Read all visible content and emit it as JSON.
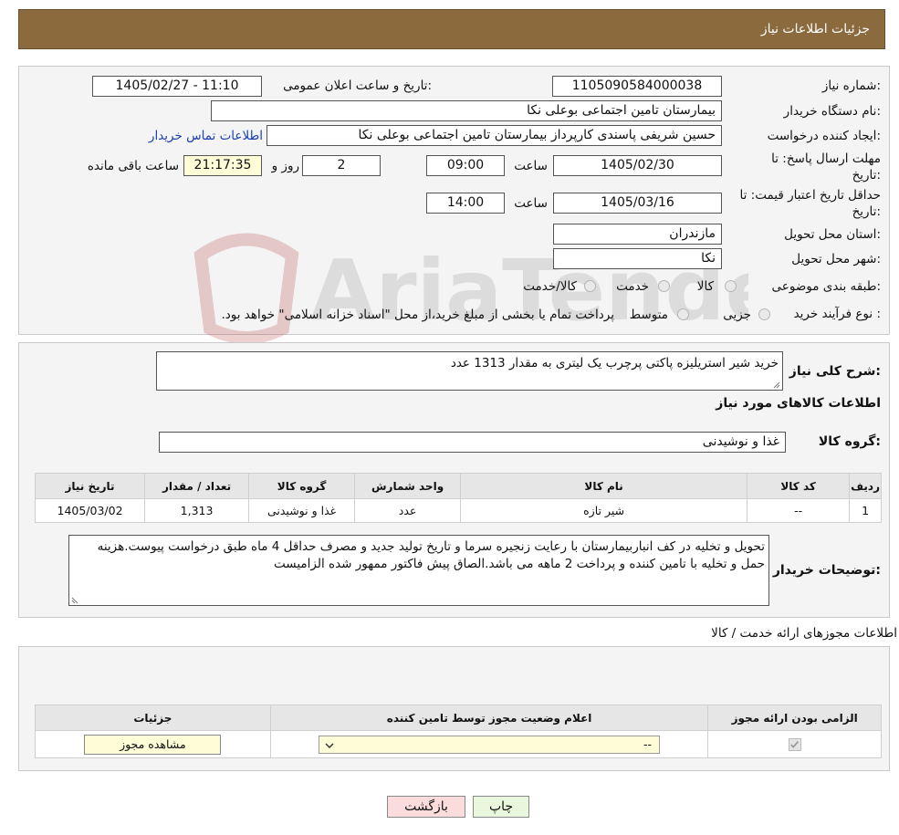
{
  "header": {
    "title": "جزئیات اطلاعات نیاز"
  },
  "watermark_text": "AriaTender.neT",
  "form": {
    "need_number": {
      "label": "شماره نیاز:",
      "value": "1105090584000038"
    },
    "announce": {
      "label": "تاریخ و ساعت اعلان عمومی:",
      "value": "1405/02/27 - 11:10"
    },
    "buyer": {
      "label": "نام دستگاه خریدار:",
      "value": "بیمارستان تامین اجتماعی بوعلی نکا"
    },
    "creator": {
      "label": "ایجاد کننده درخواست:",
      "value": "حسین شریفی پاسندی کارپرداز بیمارستان تامین اجتماعی بوعلی نکا",
      "link": "اطلاعات تماس خریدار"
    },
    "deadline": {
      "label_line1": "مهلت ارسال پاسخ: تا",
      "label_line2": "تاریخ:",
      "date": "1405/02/30",
      "time_label": "ساعت",
      "time": "09:00",
      "days": "2",
      "days_label": "روز و",
      "remaining": "21:17:35",
      "remaining_label": "ساعت باقی مانده"
    },
    "validity": {
      "label_line1": "حداقل تاریخ اعتبار قیمت: تا",
      "label_line2": "تاریخ:",
      "date": "1405/03/16",
      "time_label": "ساعت",
      "time": "14:00"
    },
    "province": {
      "label": "استان محل تحویل:",
      "value": "مازندران"
    },
    "city": {
      "label": "شهر محل تحویل:",
      "value": "نکا"
    },
    "category": {
      "label": "طبقه بندی موضوعی:",
      "options": [
        "کالا",
        "خدمت",
        "کالا/خدمت"
      ]
    },
    "process": {
      "label": "نوع فرآیند خرید :",
      "options": [
        "جزیی",
        "متوسط"
      ],
      "note": "پرداخت تمام یا بخشی از مبلغ خرید،از محل \"اسناد خزانه اسلامی\" خواهد بود."
    }
  },
  "description": {
    "label": "شرح کلی نیاز:",
    "value": "خرید شیر استریلیزه پاکتی پرچرب یک لیتری به مقدار 1313 عدد"
  },
  "goods": {
    "section_title": "اطلاعات کالاهای مورد نیاز",
    "group_label": "گروه کالا:",
    "group_value": "غذا و نوشیدنی",
    "columns": [
      "ردیف",
      "کد کالا",
      "نام کالا",
      "واحد شمارش",
      "گروه کالا",
      "تعداد / مقدار",
      "تاریخ نیاز"
    ],
    "rows": [
      [
        "1",
        "--",
        "شیر تازه",
        "عدد",
        "غذا و نوشیدنی",
        "1,313",
        "1405/03/02"
      ]
    ]
  },
  "buyer_notes": {
    "label": "توضیحات خریدار:",
    "value": "تحویل و تخلیه در کف انباربیمارستان با رعایت زنجیره سرما و تاریخ تولید جدید و مصرف حداقل 4 ماه طبق درخواست پیوست.هزینه حمل و تخلیه با تامین کننده و پرداخت 2 ماهه می باشد.الصاق پیش فاکتور ممهور شده الزامیست"
  },
  "licenses": {
    "section_title": "اطلاعات مجوزهای ارائه خدمت / کالا",
    "columns": [
      "الزامی بودن ارائه مجوز",
      "اعلام وضعیت مجوز توسط تامین کننده",
      "جزئیات"
    ],
    "select_value": "--",
    "view_button": "مشاهده مجوز"
  },
  "buttons": {
    "print": "چاپ",
    "back": "بازگشت"
  },
  "colors": {
    "header_bg": "#8b6a3e",
    "link": "#1a3fb5",
    "back_btn_bg": "#fbdcdc",
    "print_btn_bg": "#e9f7dc"
  }
}
